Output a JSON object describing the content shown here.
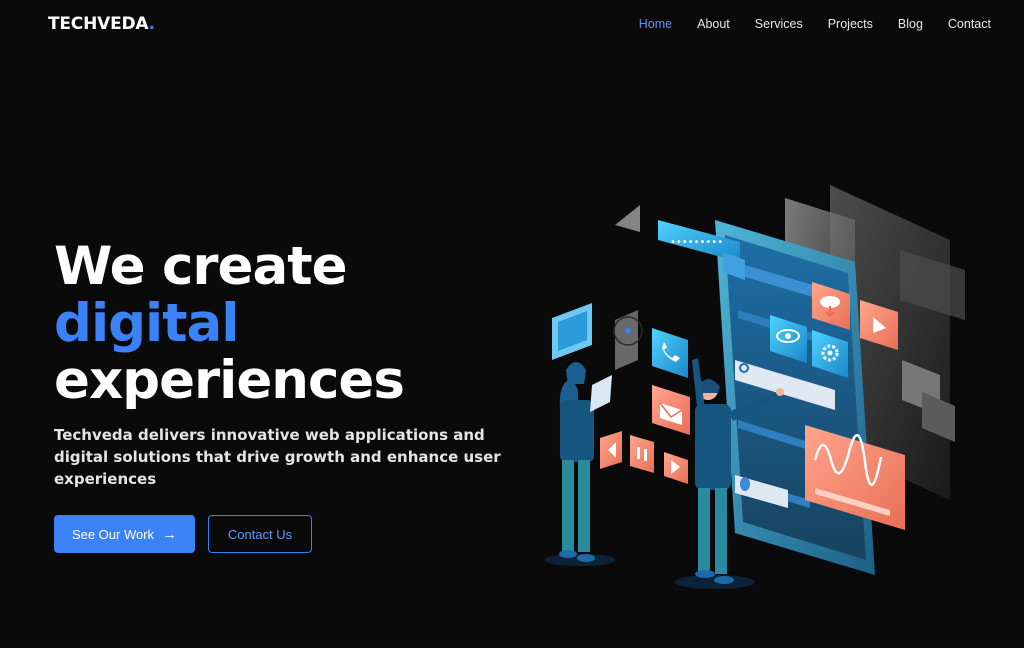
{
  "brand": {
    "name": "TECHVEDA",
    "dot": "."
  },
  "nav": {
    "items": [
      {
        "label": "Home",
        "active": true
      },
      {
        "label": "About",
        "active": false
      },
      {
        "label": "Services",
        "active": false
      },
      {
        "label": "Projects",
        "active": false
      },
      {
        "label": "Blog",
        "active": false
      },
      {
        "label": "Contact",
        "active": false
      }
    ]
  },
  "hero": {
    "line1": "We create",
    "line2": "digital",
    "line3": "experiences",
    "subtitle": "Techveda delivers innovative web applications and digital solutions that drive growth and enhance user experiences",
    "primary_button": "See Our Work",
    "primary_button_icon": "arrow-right-icon",
    "secondary_button": "Contact Us"
  },
  "colors": {
    "accent": "#3b82f6",
    "background": "#0a0a0b",
    "coral": "#f08a74",
    "cyan": "#22b4e6"
  }
}
